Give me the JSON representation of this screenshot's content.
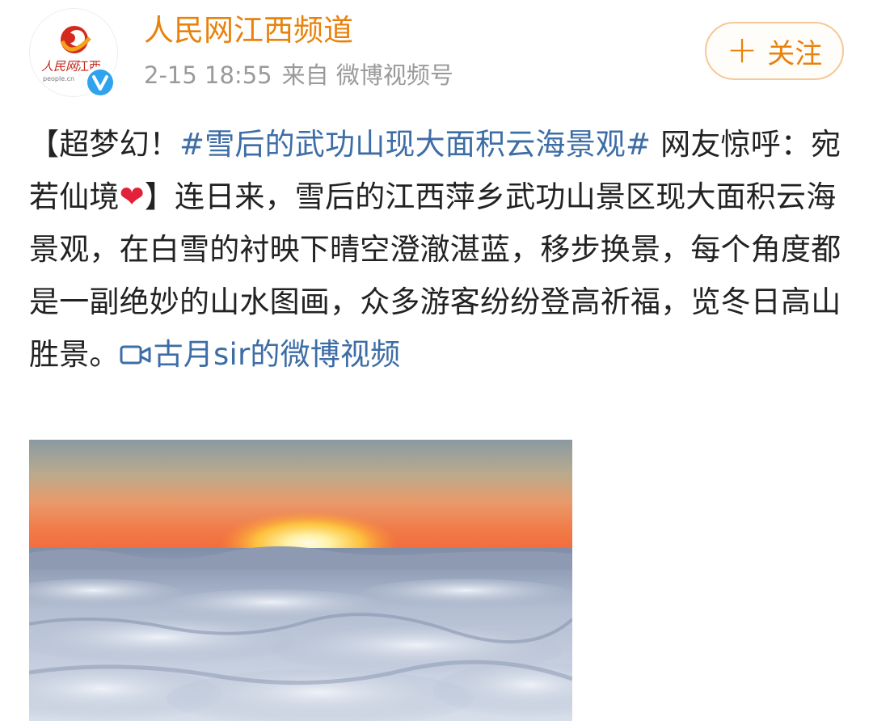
{
  "author": {
    "name": "人民网江西频道",
    "avatar_icon": "people-daily-jiangxi-logo",
    "avatar_brand_text": "人民网",
    "avatar_region_text": "江西",
    "avatar_url_text": "people.cn",
    "verified_icon": "verified-v-badge"
  },
  "meta": {
    "time": "2-15 18:55",
    "source": "来自 微博视频号"
  },
  "follow_button": {
    "icon": "plus-icon",
    "plus": "+",
    "label": "关注"
  },
  "post": {
    "prefix": "【超梦幻！",
    "hashtag": "#雪后的武功山现大面积云海景观#",
    "body": " 网友惊呼：宛若仙境",
    "heart": "❤",
    "body2": "】连日来，雪后的江西萍乡武功山景区现大面积云海景观，在白雪的衬映下晴空澄澈湛蓝，移步换景，每个角度都是一副绝妙的山水图画，众多游客纷纷登高祈福，览冬日高山胜景。",
    "video_icon": "video-camera-icon",
    "video_link": "古月sir的微博视频"
  },
  "media": {
    "description_icon": "sunrise-sea-of-clouds-photo"
  },
  "colors": {
    "author": "#e8820c",
    "link": "#3d6da6",
    "meta": "#9a9a9a",
    "text": "#222222"
  }
}
